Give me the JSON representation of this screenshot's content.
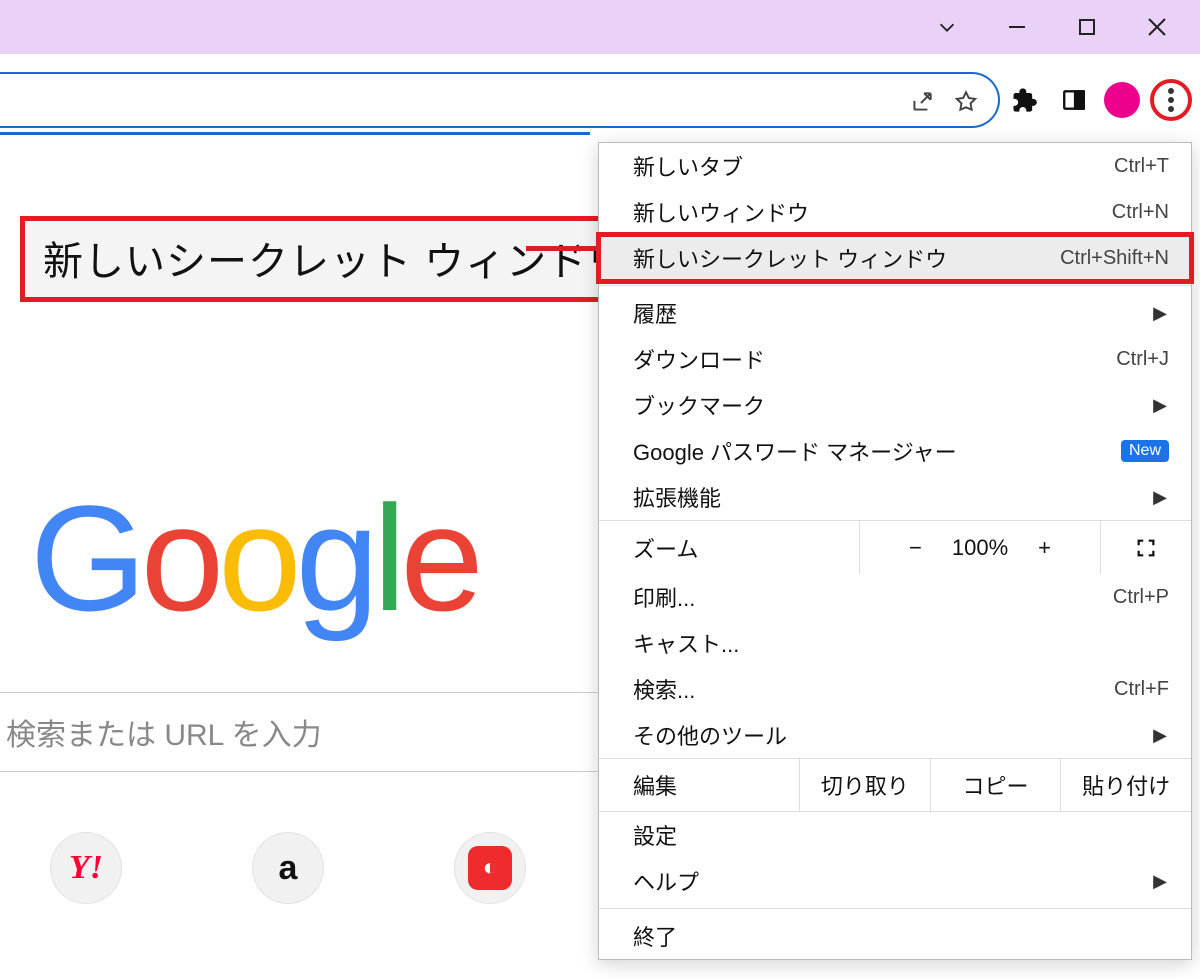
{
  "annotation_label": "新しいシークレット ウィンドウ",
  "search_placeholder": "検索または URL を入力",
  "zoom": {
    "label": "ズーム",
    "minus": "−",
    "value": "100%",
    "plus": "+"
  },
  "edit": {
    "label": "編集",
    "cut": "切り取り",
    "copy": "コピー",
    "paste": "貼り付け"
  },
  "badge_new": "New",
  "menu": [
    {
      "label": "新しいタブ",
      "shortcut": "Ctrl+T"
    },
    {
      "label": "新しいウィンドウ",
      "shortcut": "Ctrl+N"
    },
    {
      "label": "新しいシークレット ウィンドウ",
      "shortcut": "Ctrl+Shift+N",
      "highlight": true
    },
    {
      "sep": true
    },
    {
      "label": "履歴",
      "submenu": true
    },
    {
      "label": "ダウンロード",
      "shortcut": "Ctrl+J"
    },
    {
      "label": "ブックマーク",
      "submenu": true
    },
    {
      "label": "Google パスワード マネージャー",
      "badge": "New"
    },
    {
      "label": "拡張機能",
      "submenu": true
    },
    {
      "zoom": true
    },
    {
      "label": "印刷...",
      "shortcut": "Ctrl+P"
    },
    {
      "label": "キャスト..."
    },
    {
      "label": "検索...",
      "shortcut": "Ctrl+F"
    },
    {
      "label": "その他のツール",
      "submenu": true
    },
    {
      "edit": true
    },
    {
      "label": "設定"
    },
    {
      "label": "ヘルプ",
      "submenu": true
    },
    {
      "sep": true
    },
    {
      "label": "終了"
    }
  ]
}
